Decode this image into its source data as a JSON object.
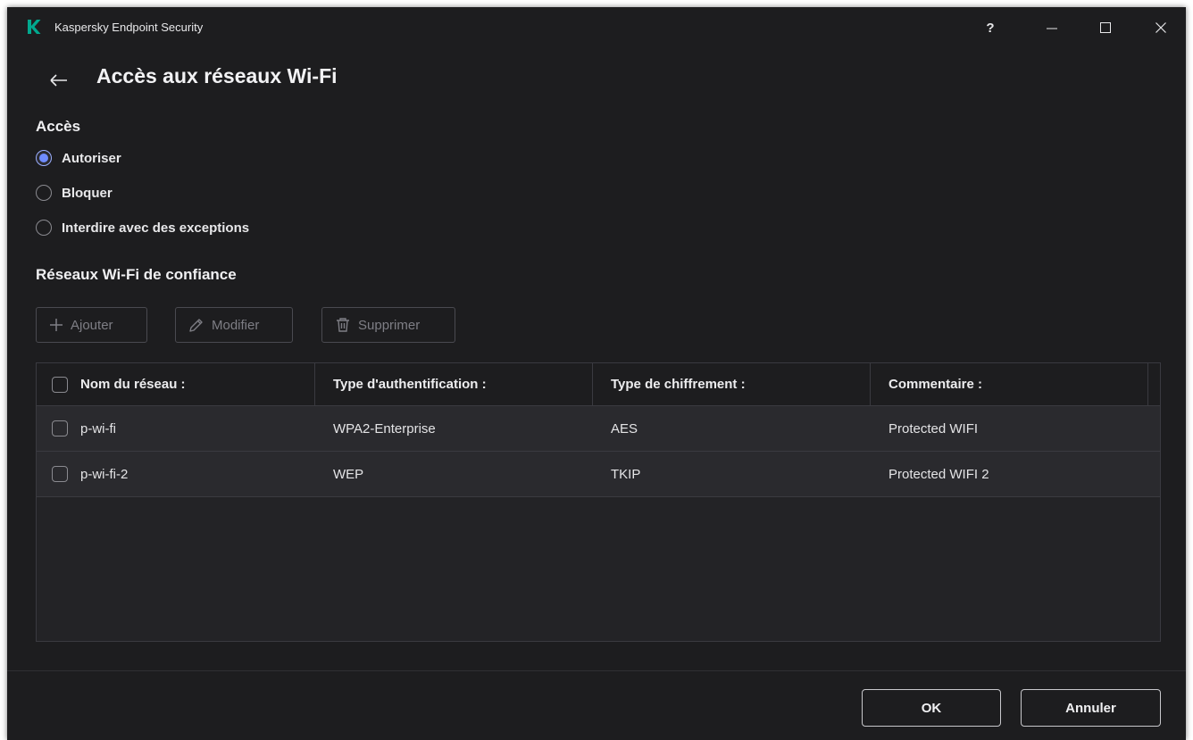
{
  "window": {
    "app_title": "Kaspersky Endpoint Security",
    "help_label": "?"
  },
  "page": {
    "title": "Accès aux réseaux Wi-Fi"
  },
  "access": {
    "section_title": "Accès",
    "options": [
      {
        "label": "Autoriser",
        "checked": true
      },
      {
        "label": "Bloquer",
        "checked": false
      },
      {
        "label": "Interdire avec des exceptions",
        "checked": false
      }
    ]
  },
  "trusted": {
    "section_title": "Réseaux Wi-Fi de confiance",
    "toolbar": {
      "add_label": "Ajouter",
      "edit_label": "Modifier",
      "delete_label": "Supprimer"
    },
    "columns": [
      "Nom du réseau :",
      "Type d'authentification :",
      "Type de chiffrement :",
      "Commentaire :"
    ],
    "rows": [
      [
        "p-wi-fi",
        "WPA2-Enterprise",
        "AES",
        "Protected WIFI"
      ],
      [
        "p-wi-fi-2",
        "WEP",
        "TKIP",
        "Protected WIFI 2"
      ]
    ]
  },
  "footer": {
    "ok_label": "OK",
    "cancel_label": "Annuler"
  },
  "colors": {
    "window_bg": "#1d1d1f",
    "accent": "#6f8cff",
    "brand_green": "#00a88e"
  }
}
